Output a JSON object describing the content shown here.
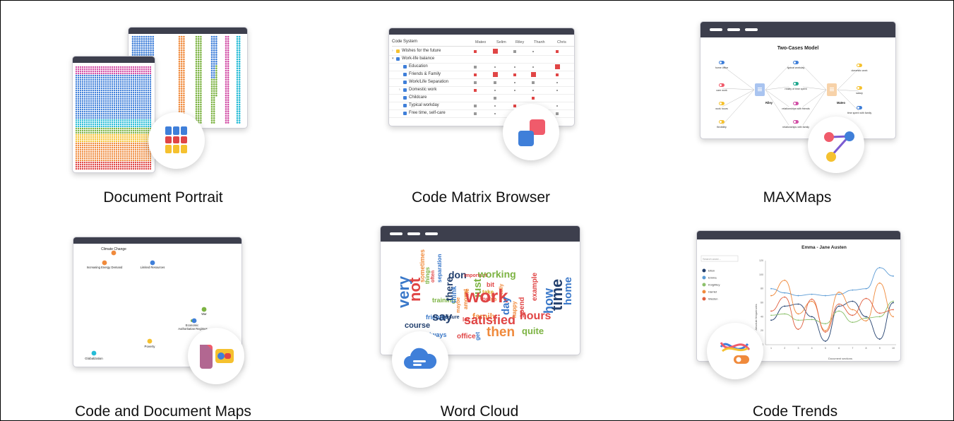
{
  "features": {
    "document_portrait": {
      "caption": "Document Portrait"
    },
    "code_matrix_browser": {
      "caption": "Code Matrix Browser",
      "header": "Code System",
      "columns": [
        "Mateo",
        "Selim",
        "Riley",
        "Thanh",
        "Chris"
      ],
      "rows": [
        "Wishes for the future",
        "Work-life balance",
        "Education",
        "Friends & Family",
        "Work/Life Separation",
        "Domestic work",
        "Childcare",
        "Typical workday",
        "Free time, self-care"
      ]
    },
    "maxmaps": {
      "caption": "MAXMaps",
      "title": "Two-Cases Model",
      "left_nodes": [
        "home office",
        "care work",
        "work hours",
        "flexibility"
      ],
      "center_left": "Riley",
      "middle_nodes": [
        "typical workday",
        "reality of time spent",
        "relationships with friends",
        "relationships with family"
      ],
      "center_right": "Mateo",
      "right_nodes": [
        "domestic work",
        "salary",
        "time spent with family"
      ]
    },
    "code_document_maps": {
      "caption": "Code and Document Maps",
      "points": [
        "Climate Change",
        "Increasing Energy Demand",
        "Limited Resources",
        "War",
        "Economic",
        "Authoritarian Regimes",
        "Poverty",
        "Globalization"
      ]
    },
    "word_cloud": {
      "caption": "Word Cloud",
      "words": [
        "very",
        "not",
        "sometimes",
        "things",
        "often",
        "separation",
        "training",
        "friends",
        "course",
        "always",
        "say",
        "there",
        "don",
        "important",
        "think",
        "maybe",
        "leisure",
        "amount",
        "life",
        "just",
        "working",
        "bit",
        "take",
        "only",
        "really",
        "go",
        "work",
        "family",
        "lot",
        "satisfied",
        "office",
        "get",
        "then",
        "day",
        "happy",
        "spend",
        "example",
        "how",
        "hours",
        "time",
        "home",
        "quite"
      ]
    },
    "code_trends": {
      "caption": "Code Trends",
      "title": "Emma - Jane Austen",
      "search_placeholder": "Search word...",
      "legend": [
        "Elton",
        "Emma",
        "Knightley",
        "Harriet",
        "Weston"
      ],
      "xlabel": "Document sections",
      "ylabel": "Absolute frequencies",
      "yticks": [
        "120",
        "100",
        "80",
        "60",
        "40",
        "20",
        "0"
      ],
      "xticks": [
        "1",
        "2",
        "3",
        "4",
        "5",
        "6",
        "7",
        "8",
        "9",
        "10"
      ]
    }
  },
  "colors": {
    "window_bar": "#3d3f4d",
    "red": "#e04545",
    "blue": "#3f7fd9",
    "orange": "#f08a3c",
    "yellow": "#f5c12f",
    "green": "#7cb342",
    "pink": "#d24fa6"
  }
}
